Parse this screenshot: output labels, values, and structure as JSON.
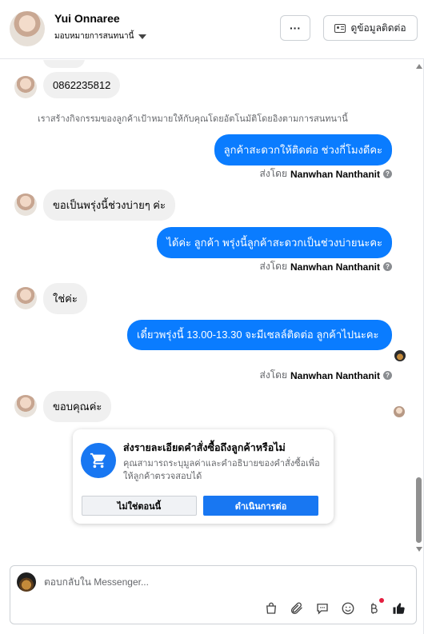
{
  "header": {
    "name": "Yui Onnaree",
    "assign_label": "มอบหมายการสนทนานี้",
    "more_label": "···",
    "view_contact_label": "ดูข้อมูลติดต่อ"
  },
  "messages": {
    "incoming_phone": "0862235812",
    "system_note": "เราสร้างกิจกรรมของลูกค้าเป้าหมายให้กับคุณโดยอัตโนมัติโดยอิงตามการสนทนานี้",
    "outgoing_1": "ลูกค้าสะดวกให้ติดต่อ ช่วงกี่โมงดีคะ",
    "incoming_2": "ขอเป็นพรุ่งนี้ช่วงบ่ายๆ ค่ะ",
    "outgoing_2": "ได้ค่ะ ลูกค้า พรุ่งนี้ลูกค้าสะดวกเป็นช่วงบ่ายนะคะ",
    "incoming_3": "ใช่ค่ะ",
    "outgoing_3": "เดี๋ยวพรุ่งนี้ 13.00-13.30 จะมีเซลล์ติดต่อ ลูกค้าไปนะคะ",
    "incoming_4": "ขอบคุณค่ะ",
    "sent_by_prefix": "ส่งโดย",
    "sender_name": "Nanwhan Nanthanit",
    "help_glyph": "?"
  },
  "order_card": {
    "title": "ส่งรายละเอียดคำสั่งซื้อถึงลูกค้าหรือไม่",
    "description": "คุณสามารถระบุมูลค่าและคำอธิบายของคำสั่งซื้อเพื่อให้ลูกค้าตรวจสอบได้",
    "decline_label": "ไม่ใช่ตอนนี้",
    "continue_label": "ดำเนินการต่อ"
  },
  "composer": {
    "placeholder": "ตอบกลับใน Messenger..."
  },
  "icons": {
    "tools": [
      "shopping-bag-icon",
      "paperclip-icon",
      "saved-replies-icon",
      "emoji-icon",
      "baht-payment-icon",
      "thumbs-up-icon"
    ],
    "brand_blue": "#0a7cff",
    "button_blue": "#1877f2"
  }
}
